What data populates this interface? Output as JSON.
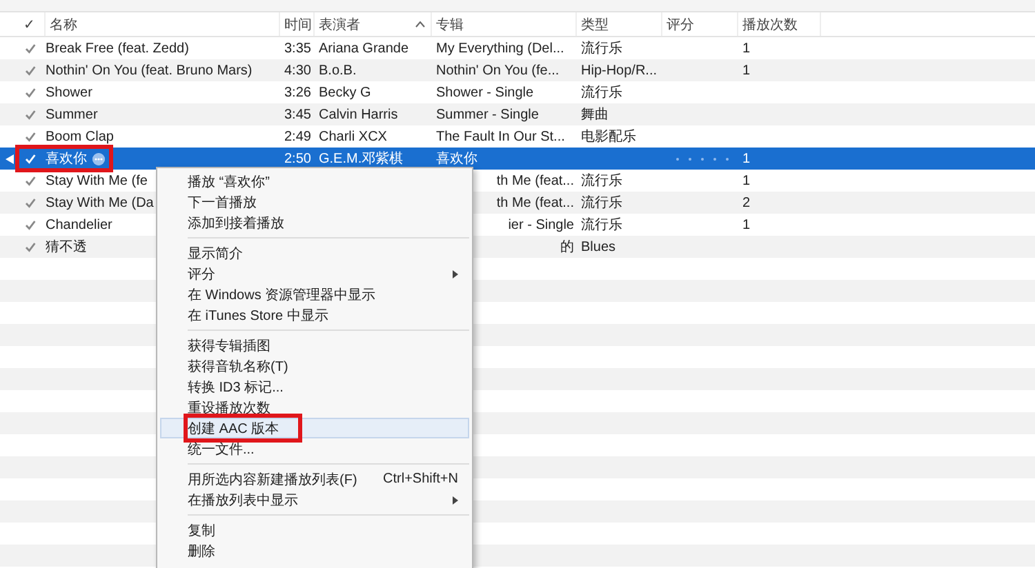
{
  "columns": {
    "check": "✓",
    "name": "名称",
    "time": "时间",
    "artist": "表演者",
    "album": "专辑",
    "genre": "类型",
    "rating": "评分",
    "plays": "播放次数"
  },
  "rows": [
    {
      "checked": true,
      "name": "Break Free (feat. Zedd)",
      "time": "3:35",
      "artist": "Ariana Grande",
      "album": "My Everything (Del...",
      "genre": "流行乐",
      "plays": "1",
      "selected": false
    },
    {
      "checked": true,
      "name": "Nothin' On You (feat. Bruno Mars)",
      "time": "4:30",
      "artist": "B.o.B.",
      "album": "Nothin' On You (fe...",
      "genre": "Hip-Hop/R...",
      "plays": "1",
      "selected": false
    },
    {
      "checked": true,
      "name": "Shower",
      "time": "3:26",
      "artist": "Becky G",
      "album": "Shower - Single",
      "genre": "流行乐",
      "selected": false
    },
    {
      "checked": true,
      "name": "Summer",
      "time": "3:45",
      "artist": "Calvin Harris",
      "album": "Summer - Single",
      "genre": "舞曲",
      "selected": false
    },
    {
      "checked": true,
      "name": "Boom Clap",
      "time": "2:49",
      "artist": "Charli XCX",
      "album": "The Fault In Our St...",
      "genre": "电影配乐",
      "selected": false
    },
    {
      "checked": true,
      "name": "喜欢你",
      "time": "2:50",
      "artist": "G.E.M.邓紫棋",
      "album": "喜欢你",
      "plays": "1",
      "selected": true,
      "playing": true,
      "more_button": true,
      "marked": true
    },
    {
      "checked": true,
      "name": "Stay With Me (fe",
      "album": "th Me (feat...",
      "genre": "流行乐",
      "plays": "1",
      "selected": false,
      "covered": true
    },
    {
      "checked": true,
      "name": "Stay With Me (Da",
      "album": "th Me (feat...",
      "genre": "流行乐",
      "plays": "2",
      "selected": false,
      "covered": true
    },
    {
      "checked": true,
      "name": "Chandelier",
      "album": "ier - Single",
      "genre": "流行乐",
      "plays": "1",
      "selected": false,
      "covered": true
    },
    {
      "checked": true,
      "name": "猜不透",
      "album": "的",
      "genre": "Blues",
      "selected": false,
      "covered": true
    }
  ],
  "context_menu": {
    "groups": [
      [
        {
          "label": "播放 “喜欢你”"
        },
        {
          "label": "下一首播放"
        },
        {
          "label": "添加到接着播放"
        }
      ],
      [
        {
          "label": "显示简介"
        },
        {
          "label": "评分",
          "submenu": true
        },
        {
          "label": "在 Windows 资源管理器中显示"
        },
        {
          "label": "在 iTunes Store 中显示"
        }
      ],
      [
        {
          "label": "获得专辑插图"
        },
        {
          "label": "获得音轨名称(T)"
        },
        {
          "label": "转换 ID3 标记..."
        },
        {
          "label": "重设播放次数"
        },
        {
          "label": "创建 AAC 版本",
          "highlighted": true,
          "marked": true
        },
        {
          "label": "统一文件..."
        }
      ],
      [
        {
          "label": "用所选内容新建播放列表(F)",
          "shortcut": "Ctrl+Shift+N"
        },
        {
          "label": "在播放列表中显示",
          "submenu": true
        }
      ],
      [
        {
          "label": "复制"
        },
        {
          "label": "删除"
        }
      ]
    ]
  }
}
